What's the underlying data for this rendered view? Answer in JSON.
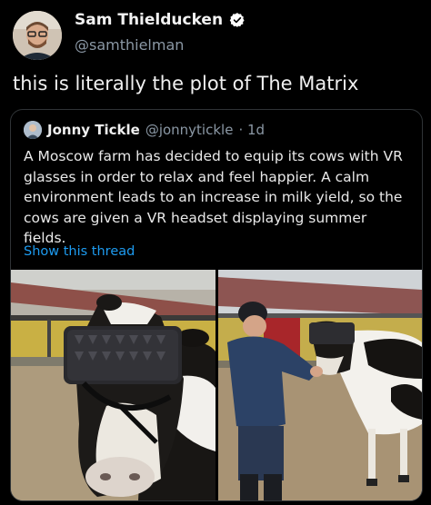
{
  "tweet": {
    "author_name": "Sam Thielducken",
    "author_handle": "@samthielman",
    "text": "this is literally the plot of The Matrix",
    "avatar_icon": "user-avatar",
    "verified_icon": "verified-badge-icon"
  },
  "quote": {
    "author_name": "Jonny Tickle",
    "author_handle": "@jonnytickle",
    "time": "· 1d",
    "text": "A Moscow farm has decided to equip its cows with VR glasses in order to relax and feel happier. A calm environment leads to an increase in milk yield, so the cows are given a VR headset displaying summer fields.",
    "ellipsis": "...",
    "thread_link": "Show this thread"
  },
  "colors": {
    "background": "#000000",
    "link": "#1d9bf0",
    "secondary_text": "#8b98a5",
    "verified": "#ffffff"
  }
}
